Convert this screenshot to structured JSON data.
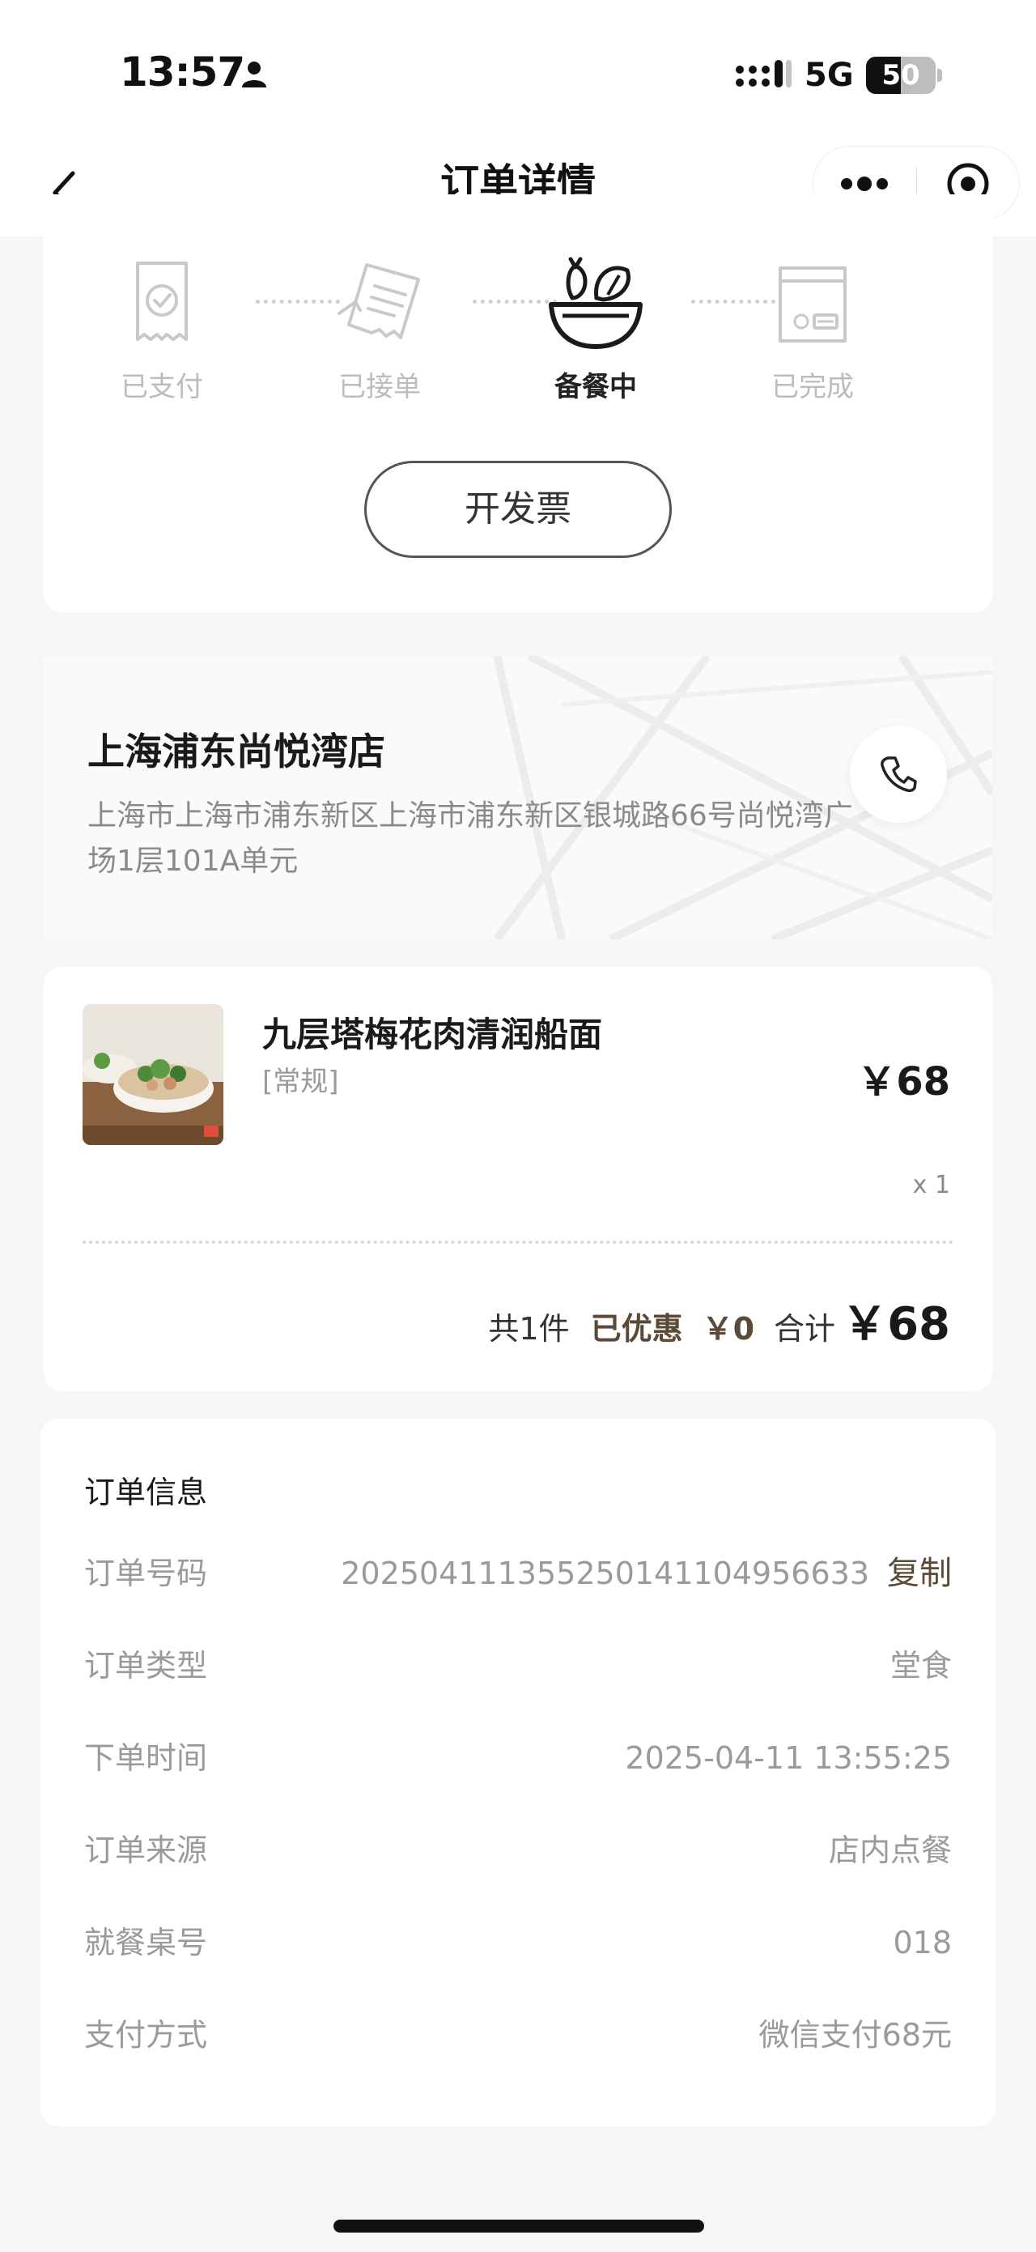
{
  "status_bar": {
    "time": "13:57",
    "network": "5G",
    "battery": "50",
    "battery_level_percent": 50,
    "icons": [
      "person-icon",
      "signal-icon"
    ]
  },
  "nav": {
    "title": "订单详情",
    "icons": [
      "back-arrow-icon",
      "more-dots-icon",
      "close-circle-icon"
    ]
  },
  "progress": {
    "steps": [
      {
        "label": "已支付",
        "icon": "receipt-check-icon",
        "active": false
      },
      {
        "label": "已接单",
        "icon": "receipt-list-icon",
        "active": false
      },
      {
        "label": "备餐中",
        "icon": "veggie-bowl-icon",
        "active": true
      },
      {
        "label": "已完成",
        "icon": "takeout-bag-icon",
        "active": false
      }
    ],
    "invoice_button": "开发票"
  },
  "store": {
    "name": "上海浦东尚悦湾店",
    "address": "上海市上海市浦东新区上海市浦东新区银城路66号尚悦湾广场1层101A单元",
    "call_icon": "phone-icon"
  },
  "order_item": {
    "name": "九层塔梅花肉清润船面",
    "spec": "[常规]",
    "price": "￥68",
    "quantity": "x 1",
    "image": "noodle-bowl-photo"
  },
  "summary": {
    "count": "共1件",
    "discount_label": "已优惠",
    "discount_value": "￥0",
    "total_label": "合计",
    "total_value": "￥68"
  },
  "order_info": {
    "title": "订单信息",
    "copy_label": "复制",
    "rows": [
      {
        "label": "订单号码",
        "value": "2025041113552501411​04956633"
      },
      {
        "label": "订单类型",
        "value": "堂食"
      },
      {
        "label": "下单时间",
        "value": "2025-04-11 13:55:25"
      },
      {
        "label": "订单来源",
        "value": "店内点餐"
      },
      {
        "label": "就餐桌号",
        "value": "018"
      },
      {
        "label": "支付方式",
        "value": "微信支付68元"
      }
    ]
  },
  "colors": {
    "accent_brown": "#5b4a38",
    "muted_text": "#9a9a9a",
    "background": "#f6f6f6"
  }
}
